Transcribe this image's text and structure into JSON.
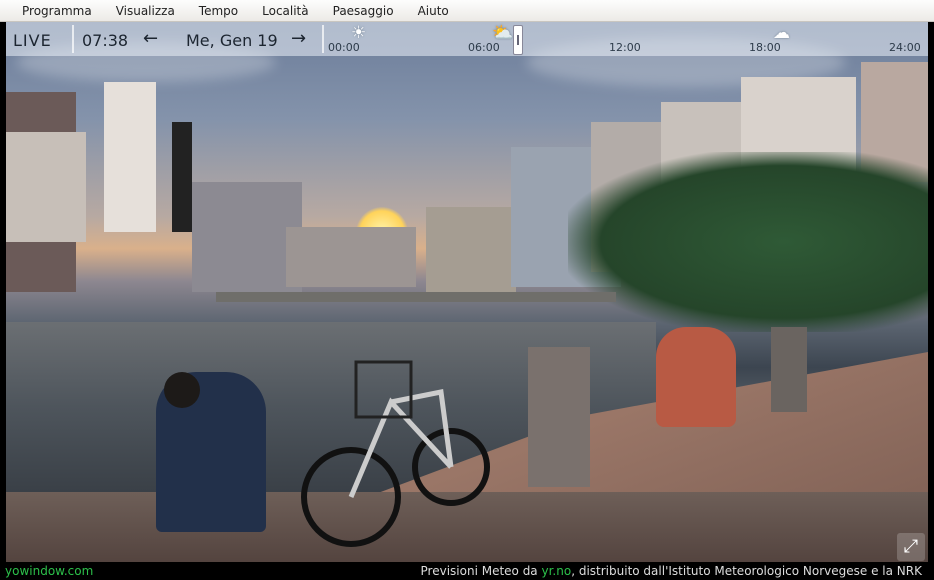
{
  "menu": {
    "items": [
      "Programma",
      "Visualizza",
      "Tempo",
      "Località",
      "Paesaggio",
      "Aiuto"
    ]
  },
  "timebar": {
    "live": "LIVE",
    "clock": "07:38",
    "date": "Me, Gen 19",
    "left_arrow": "←",
    "right_arrow": "→",
    "ticks": [
      "00:00",
      "06:00",
      "12:00",
      "18:00",
      "24:00"
    ],
    "weather_icons": [
      "sun-icon",
      "partly-cloudy-icon",
      "cloud-icon"
    ],
    "time_position": 0.325
  },
  "footer": {
    "brand": "yowindow.com",
    "credit_prefix": "Previsioni Meteo da",
    "credit_link": "yr.no",
    "credit_suffix": ", distribuito dall'Istituto Meteorologico Norvegese e la NRK"
  },
  "colors": {
    "brand_green": "#2cc04a",
    "menu_bg": "#f4f3f0"
  }
}
